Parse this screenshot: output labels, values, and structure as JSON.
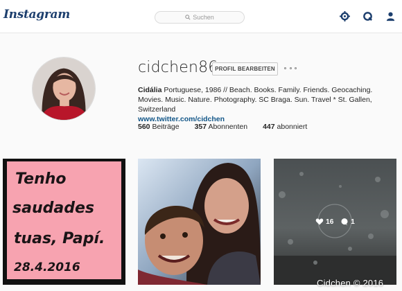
{
  "header": {
    "logo": "Instagram",
    "search_placeholder": "Suchen",
    "icons": [
      "compass-icon",
      "activity-icon",
      "profile-icon"
    ]
  },
  "profile": {
    "username": "cidchen86",
    "edit_label": "PROFIL BEARBEITEN",
    "full_name": "Cidália",
    "bio_text": "Portuguese, 1986 // Beach. Books. Family. Friends. Geocaching. Movies. Music. Nature. Photography. SC Braga. Sun. Travel * St. Gallen, Switzerland",
    "link": "www.twitter.com/cidchen",
    "stats": [
      {
        "count": "560",
        "label": "Beiträge"
      },
      {
        "count": "357",
        "label": "Abonnenten"
      },
      {
        "count": "447",
        "label": "abonniert"
      }
    ]
  },
  "posts": [
    {
      "handwriting": [
        "Tenho",
        "saudades",
        "tuas, Papí.",
        "28.4.2016"
      ]
    },
    {},
    {
      "likes": "16",
      "comments": "1"
    }
  ],
  "watermark": "Cidchen © 2016",
  "colors": {
    "accent": "#125688",
    "logo": "#1d3f6e",
    "nav_icon": "#1d3f6e"
  }
}
